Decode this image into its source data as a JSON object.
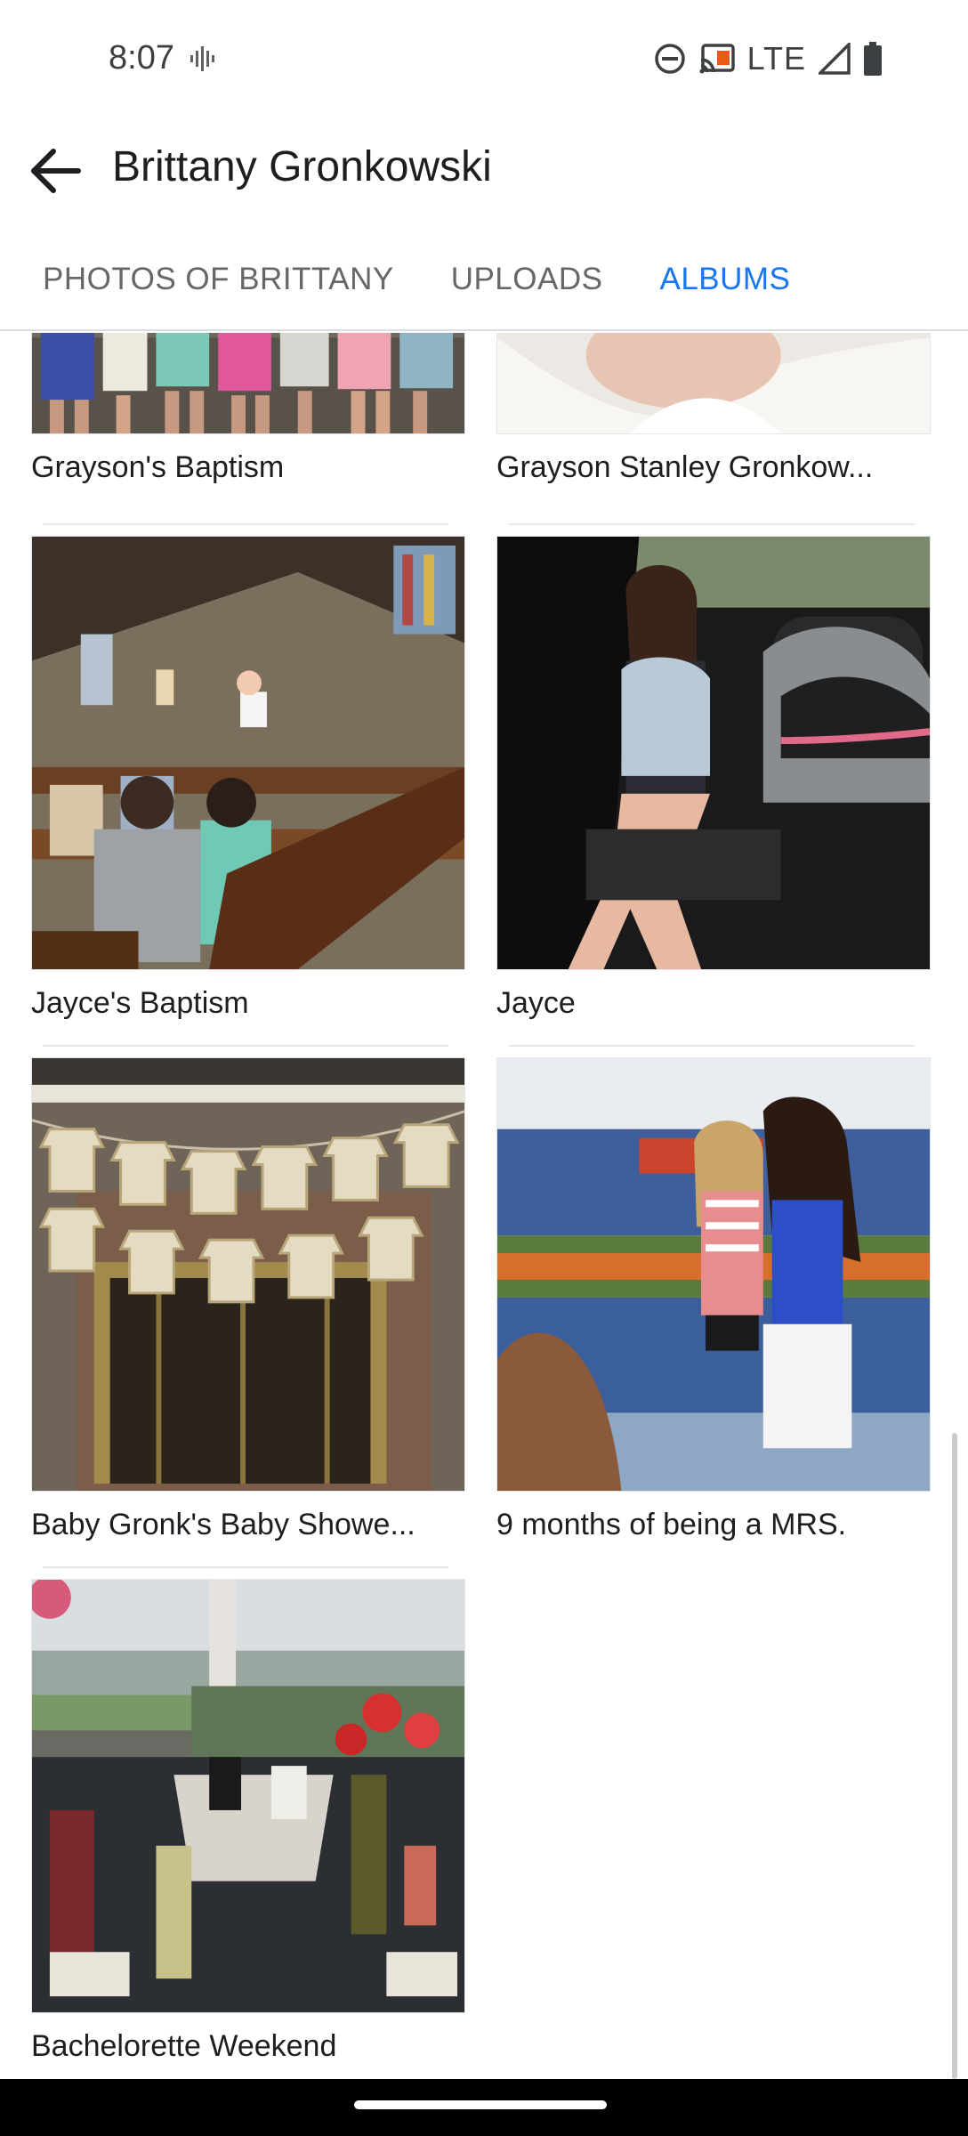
{
  "status_bar": {
    "time": "8:07",
    "network": "LTE",
    "icons": [
      "vibrate-icon",
      "do-not-disturb-icon",
      "cast-icon",
      "signal-icon",
      "battery-icon"
    ]
  },
  "header": {
    "back_icon": "back-arrow-icon",
    "title": "Brittany Gronkowski"
  },
  "tabs": [
    {
      "label": "PHOTOS OF BRITTANY",
      "active": false
    },
    {
      "label": "UPLOADS",
      "active": false
    },
    {
      "label": "ALBUMS",
      "active": true
    }
  ],
  "albums": [
    {
      "title": "Grayson's Baptism"
    },
    {
      "title": "Grayson Stanley Gronkow..."
    },
    {
      "title": "Jayce's Baptism"
    },
    {
      "title": "Jayce"
    },
    {
      "title": "Baby Gronk's Baby Showe..."
    },
    {
      "title": "9 months of being a MRS."
    },
    {
      "title": "Bachelorette Weekend"
    }
  ],
  "colors": {
    "accent": "#1877f2",
    "tab_inactive": "#65676b",
    "text": "#1c1e21",
    "divider": "#e4e6eb"
  }
}
